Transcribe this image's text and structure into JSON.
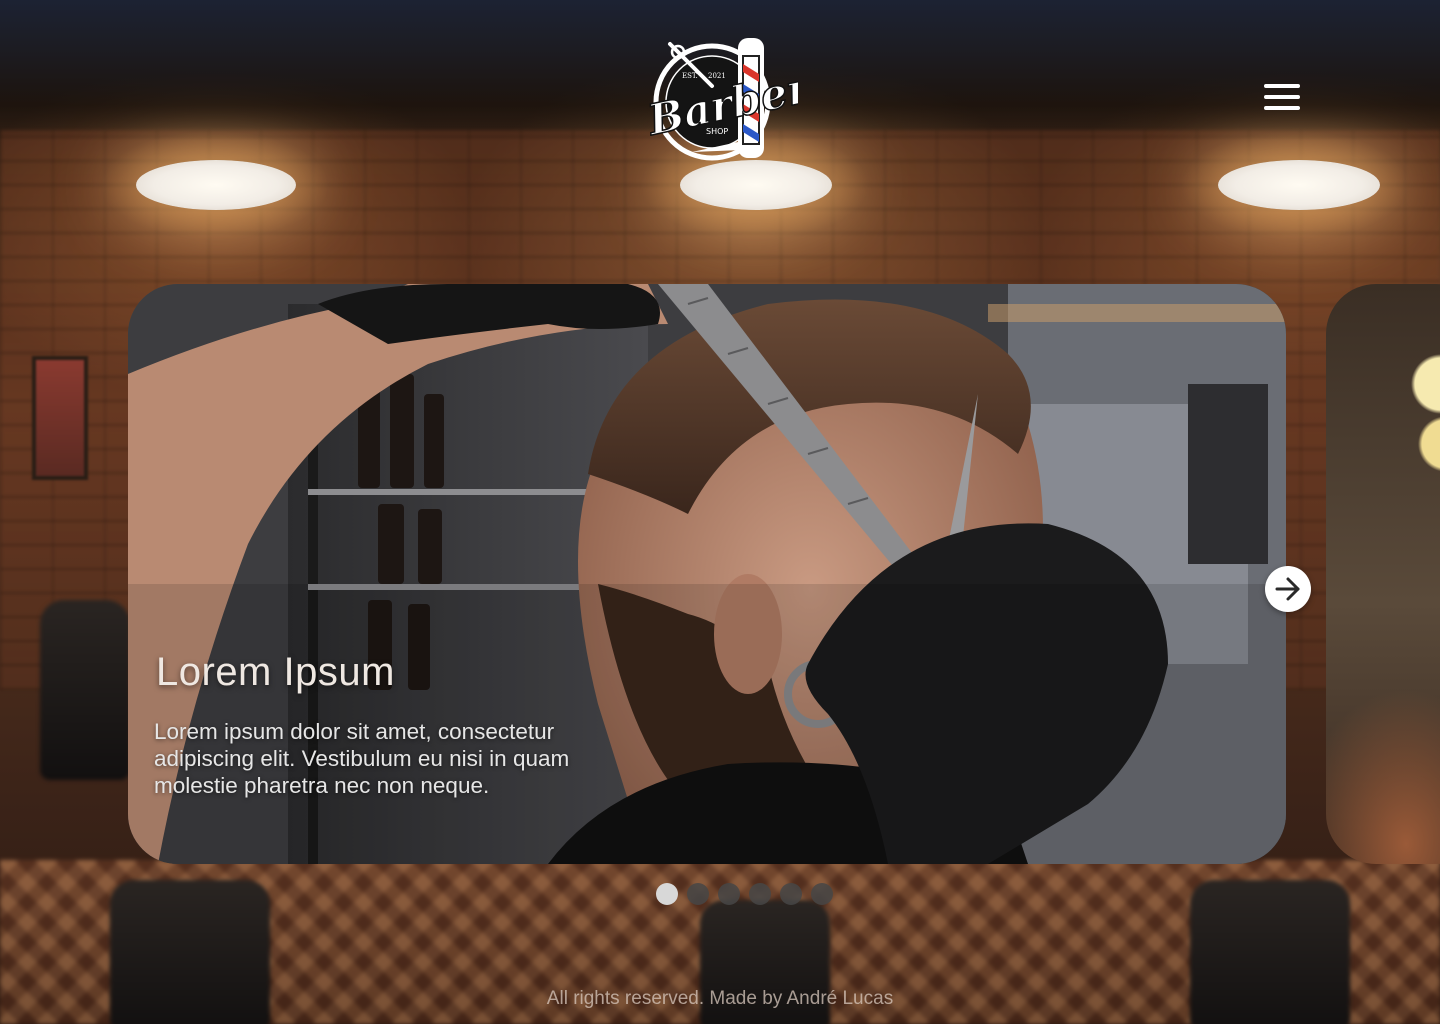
{
  "header": {
    "logo": {
      "text": "Barber",
      "subtext": "SHOP",
      "est": "EST.",
      "year": "2021"
    },
    "menu_icon": "hamburger-menu-icon"
  },
  "slider": {
    "slides": [
      {
        "title": "Lorem Ipsum",
        "text": "Lorem ipsum dolor sit amet, consectetur adipiscing elit. Vestibulum eu nisi in quam molestie pharetra nec non neque."
      }
    ],
    "next_icon": "arrow-right-icon",
    "dot_count": 6,
    "active_dot": 1
  },
  "footer": {
    "text": "All rights reserved. Made by André Lucas"
  },
  "colors": {
    "header_dark": "#1c2233",
    "text_light": "#efe8e2",
    "dot_active": "#d8d8d8",
    "dot_inactive": "#464646",
    "arrow_bg": "#ffffff"
  }
}
